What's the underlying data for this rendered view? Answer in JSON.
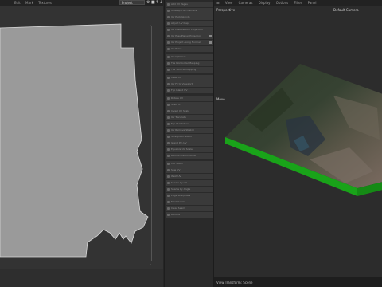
{
  "left_panel": {
    "menu": [
      "Edit",
      "Mark",
      "Textures"
    ],
    "project_select": "Project",
    "toolbar_icons": [
      "gear-icon",
      "trash-icon",
      "upload-icon",
      "download-icon"
    ],
    "ruler": {
      "tick_top": "1",
      "tick_bottom": "0"
    }
  },
  "operators": {
    "group1": [
      {
        "label": "Add UV Pages",
        "checked": false
      },
      {
        "label": "Unwrap from Camera",
        "checked": false
      },
      {
        "label": "UV Pack Islands",
        "checked": false
      },
      {
        "label": "Adjust UV Map",
        "checked": false
      },
      {
        "label": "UV Pass Vertical Projection",
        "checked": false
      },
      {
        "label": "UV Pass Planar Projection",
        "checked": true
      },
      {
        "label": "UV Project Along Normal",
        "checked": true
      },
      {
        "label": "UV Relax",
        "checked": false
      }
    ],
    "group2": [
      {
        "label": "UV Optimize",
        "checked": false
      },
      {
        "label": "Tile Horizontal Mapping",
        "checked": false
      },
      {
        "label": "Tile Vertical Mapping",
        "checked": false
      }
    ],
    "group3": [
      {
        "label": "Mask UV",
        "checked": false
      },
      {
        "label": "UV Fit to Viewport",
        "checked": false
      },
      {
        "label": "Flip Island UV",
        "checked": false
      }
    ],
    "group4": [
      {
        "label": "Rotate UV",
        "checked": false
      },
      {
        "label": "Scale UV",
        "checked": false
      },
      {
        "label": "Invert UV Scale",
        "checked": false
      },
      {
        "label": "UV Translate",
        "checked": false
      },
      {
        "label": "Flip UV Vertical",
        "checked": false
      },
      {
        "label": "UV Remove Stretch",
        "checked": false
      },
      {
        "label": "Straighten Island",
        "checked": false
      },
      {
        "label": "Island Pin UV",
        "checked": false
      },
      {
        "label": "Equalize UV Scale",
        "checked": false
      },
      {
        "label": "Randomize UV Scale",
        "checked": false
      }
    ],
    "group5": [
      {
        "label": "Cut Seam",
        "checked": false
      },
      {
        "label": "Sew UV",
        "checked": false
      },
      {
        "label": "Weld UV",
        "checked": false
      },
      {
        "label": "Seams by UV",
        "checked": false
      },
      {
        "label": "Seams by Angle",
        "checked": false
      },
      {
        "label": "Edge Sharpness",
        "checked": false
      },
      {
        "label": "Mark Seam",
        "checked": false
      },
      {
        "label": "Clear Seam",
        "checked": false
      },
      {
        "label": "Reduce",
        "checked": false
      }
    ]
  },
  "viewport": {
    "menu": [
      "View",
      "Cameras",
      "Display",
      "Options",
      "Filter",
      "Panel"
    ],
    "projection_label": "Perspective",
    "camera_label": "Default Camera",
    "move_label": "Move",
    "status": "View Transform: Scene",
    "colors": {
      "terrain_skirt": "#19a319",
      "uv_island_fill": "#9a9a9a"
    }
  }
}
